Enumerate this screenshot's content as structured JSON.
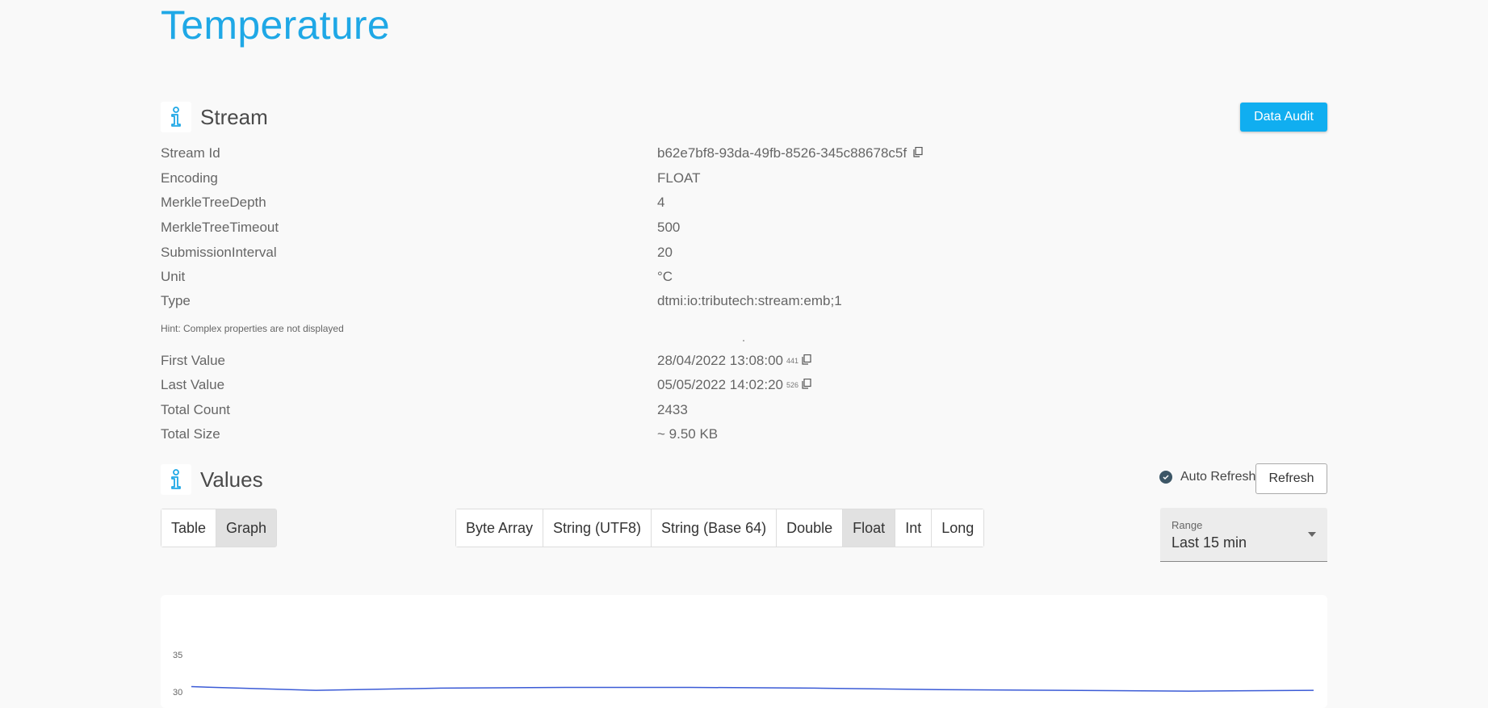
{
  "page": {
    "title": "Temperature"
  },
  "stream_section": {
    "title": "Stream",
    "data_audit_label": "Data Audit"
  },
  "properties": [
    {
      "label": "Stream Id",
      "value": "b62e7bf8-93da-49fb-8526-345c88678c5f",
      "copy": true
    },
    {
      "label": "Encoding",
      "value": "FLOAT"
    },
    {
      "label": "MerkleTreeDepth",
      "value": "4"
    },
    {
      "label": "MerkleTreeTimeout",
      "value": "500"
    },
    {
      "label": "SubmissionInterval",
      "value": "20"
    },
    {
      "label": "Unit",
      "value": "°C"
    },
    {
      "label": "Type",
      "value": "dtmi:io:tributech:stream:emb;1"
    }
  ],
  "hint": "Hint: Complex properties are not displayed",
  "stats": [
    {
      "label": "First Value",
      "value": "28/04/2022 13:08:00",
      "ms": "441",
      "copy": true
    },
    {
      "label": "Last Value",
      "value": "05/05/2022 14:02:20",
      "ms": "526",
      "copy": true
    },
    {
      "label": "Total Count",
      "value": "2433"
    },
    {
      "label": "Total Size",
      "value": "~ 9.50 KB"
    }
  ],
  "values_section": {
    "title": "Values",
    "auto_refresh_label": "Auto Refresh",
    "auto_refresh_checked": true,
    "refresh_label": "Refresh"
  },
  "view_toggle": {
    "options": [
      "Table",
      "Graph"
    ],
    "selected": "Graph"
  },
  "type_toggle": {
    "options": [
      "Byte Array",
      "String (UTF8)",
      "String (Base 64)",
      "Double",
      "Float",
      "Int",
      "Long"
    ],
    "selected": "Float"
  },
  "range": {
    "label": "Range",
    "value": "Last 15 min"
  },
  "colors": {
    "accent": "#10aef0",
    "title": "#1fa8e6",
    "line": "#3b5bd6"
  },
  "chart_data": {
    "type": "line",
    "y_ticks": [
      "35",
      "30"
    ],
    "ylim": [
      30,
      35
    ],
    "series": [
      {
        "values": [
          30.7,
          30.2,
          30.5,
          30.6,
          30.6,
          30.5,
          30.3,
          30.2,
          30.1,
          30.2
        ]
      }
    ]
  }
}
